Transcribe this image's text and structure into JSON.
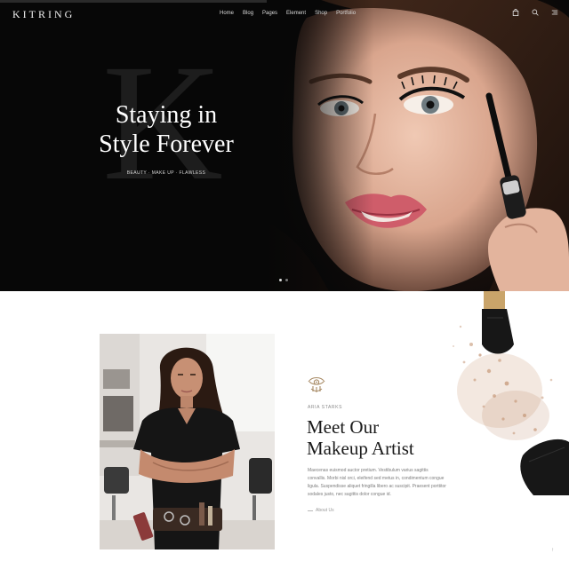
{
  "header": {
    "logo": "KITRING",
    "nav": [
      "Home",
      "Blog",
      "Pages",
      "Element",
      "Shop",
      "Portfolio"
    ],
    "icons": [
      "shopping-bag-icon",
      "search-icon",
      "menu-icon"
    ]
  },
  "hero": {
    "watermark_letter": "K",
    "title_line1": "Staying in",
    "title_line2": "Style Forever",
    "tags": "BEAUTY · MAKE UP · FLAWLESS",
    "slide_count": 2,
    "active_slide": 1
  },
  "artist": {
    "icon": "eye-icon",
    "subtitle": "ARIA STARKS",
    "title_line1": "Meet Our",
    "title_line2": "Makeup Artist",
    "paragraph": "Maecenas euismod auctor pretium. Vestibulum varius sagittis convallis. Morbi nisl orci, eleifend sed metus in, condimentum congue ligula. Suspendisse aliquet fringilla libero ac suscipit. Praesent porttitor sodales justo, nec sagittis dolor congue id.",
    "link": "About Us"
  },
  "footer": {
    "scroll_top": "↑"
  },
  "colors": {
    "hero_bg": "#070707",
    "title_dark": "#1b1b1b",
    "text_muted": "#7c7c7c",
    "accent_gold": "#a88b66"
  }
}
